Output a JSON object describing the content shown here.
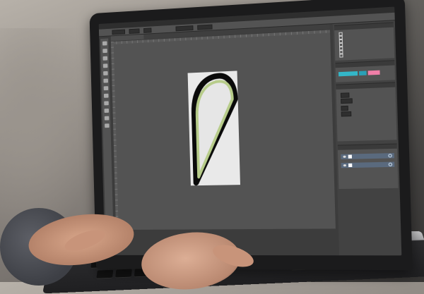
{
  "scene": {
    "description_colors": {
      "shape_stroke_green": "#b7cc8a",
      "shape_shadow_black": "#0a0a0a",
      "swatch_teal": "#33b6c8",
      "swatch_teal_dark": "#2aa0b6",
      "swatch_pink": "#f07fa8",
      "layer_selected": "#5a6a7e"
    }
  },
  "app": {
    "menu_items": [
      "",
      "",
      "",
      "",
      "",
      "",
      "",
      "",
      ""
    ],
    "options_bar": {
      "field1": "",
      "field2": ""
    },
    "document_tab": ""
  },
  "tools": [
    "selection-tool",
    "direct-selection-tool",
    "pen-tool",
    "type-tool",
    "line-tool",
    "shape-tool",
    "brush-tool",
    "rotate-tool",
    "scale-tool",
    "eyedropper-tool",
    "hand-tool",
    "zoom-tool"
  ],
  "panels": {
    "actions_rows": [
      "",
      "",
      "",
      "",
      "",
      "",
      "",
      ""
    ],
    "swatches": [
      "#33b6c8",
      "#2aa0b6",
      "#f07fa8"
    ],
    "layers": [
      "",
      ""
    ]
  }
}
